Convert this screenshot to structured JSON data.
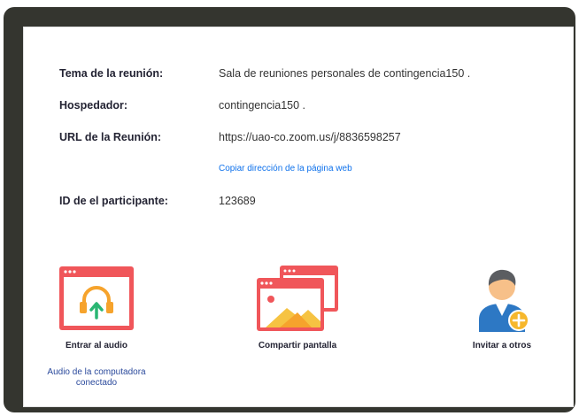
{
  "meeting_info": {
    "topic_label": "Tema de la reunión:",
    "topic_value": "Sala de reuniones personales de contingencia150 .",
    "host_label": "Hospedador:",
    "host_value": "contingencia150 .",
    "url_label": "URL de la Reunión:",
    "url_value": "https://uao-co.zoom.us/j/8836598257",
    "copy_link_label": "Copiar dirección de la página web",
    "participant_id_label": "ID de el participante:",
    "participant_id_value": "123689"
  },
  "actions": {
    "join_audio": {
      "label": "Entrar al audio",
      "status": "Audio de la computadora conectado",
      "icon": "headphones-icon"
    },
    "share_screen": {
      "label": "Compartir pantalla",
      "icon": "share-screen-icon"
    },
    "invite": {
      "label": "Invitar a otros",
      "icon": "invite-user-icon"
    }
  },
  "colors": {
    "frame": "#34352f",
    "icon_red": "#f0565a",
    "icon_orange": "#f6a32c",
    "link_blue": "#0e71eb",
    "accent_green": "#2ab673",
    "user_blue": "#2d78c4"
  }
}
